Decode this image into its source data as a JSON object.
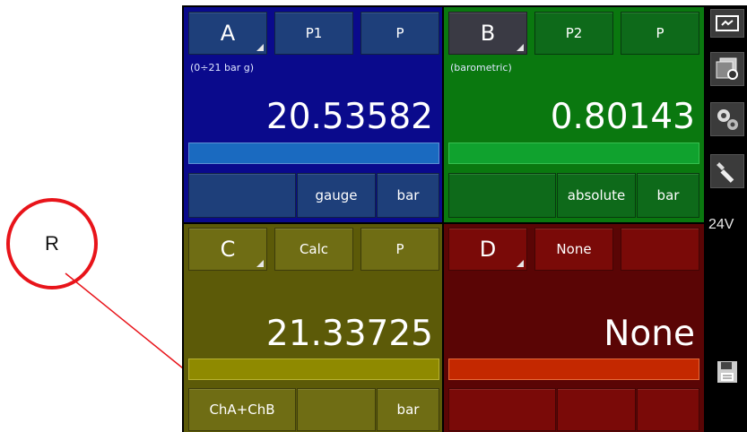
{
  "annotation": {
    "label": "R",
    "color": "#e8141a"
  },
  "channels": {
    "A": {
      "letter": "A",
      "source": "P1",
      "mode": "P",
      "range": "(0÷21 bar g)",
      "value": "20.53582",
      "bottom": [
        "",
        "gauge",
        "bar"
      ],
      "color": "#0a0a8c"
    },
    "B": {
      "letter": "B",
      "source": "P2",
      "mode": "P",
      "range": "(barometric)",
      "value": "0.80143",
      "bottom": [
        "",
        "absolute",
        "bar"
      ],
      "color": "#0a780f"
    },
    "C": {
      "letter": "C",
      "source": "Calc",
      "mode": "P",
      "value": "21.33725",
      "bottom": [
        "ChA+ChB",
        "",
        "bar"
      ],
      "color": "#5c5a08"
    },
    "D": {
      "letter": "D",
      "source": "None",
      "mode": "",
      "value": "None",
      "bottom": [
        "",
        "",
        ""
      ],
      "color": "#5a0505"
    }
  },
  "sidebar": {
    "icons": [
      "power-icon",
      "window-settings-icon",
      "gears-icon",
      "wrench-icon",
      "save-icon"
    ],
    "voltage": "24V"
  }
}
